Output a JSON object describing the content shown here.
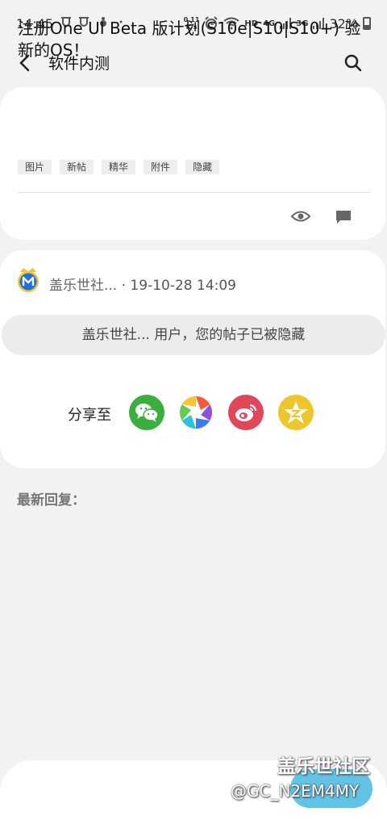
{
  "status_bar": {
    "time": "14:45",
    "net_speed_value": "0.11",
    "net_speed_unit": "K/s",
    "network_4g": "4G",
    "network_3g": "3G",
    "hd_label": "HD",
    "battery": "32%"
  },
  "app_bar": {
    "title": "软件内测",
    "back_icon": "back-arrow-icon",
    "search_icon": "search-icon"
  },
  "post": {
    "title": "注册One UI Beta 版计划(S10e|S10|S10+) 验新的OS！",
    "tags": [
      "图片",
      "新帖",
      "精华",
      "附件",
      "隐藏"
    ],
    "author": "盖乐世社...",
    "timestamp": "· 19-10-28 14:09",
    "hidden_notice": "盖乐世社... 用户，您的帖子已被隐藏",
    "share_label": "分享至",
    "share_targets": [
      "wechat-icon",
      "moments-icon",
      "weibo-icon",
      "qzone-icon"
    ]
  },
  "replies": {
    "heading": "最新回复："
  },
  "watermark": {
    "forum": "盖乐世社区",
    "user": "@GC_N2EM4MY"
  },
  "colors": {
    "wechat": "#3bae3e",
    "weibo": "#e1475a",
    "qzone": "#ecc62a",
    "reply_button": "#63c3e6",
    "avatar_ring": "#f4c430",
    "avatar_fill": "#1f6fe0"
  }
}
